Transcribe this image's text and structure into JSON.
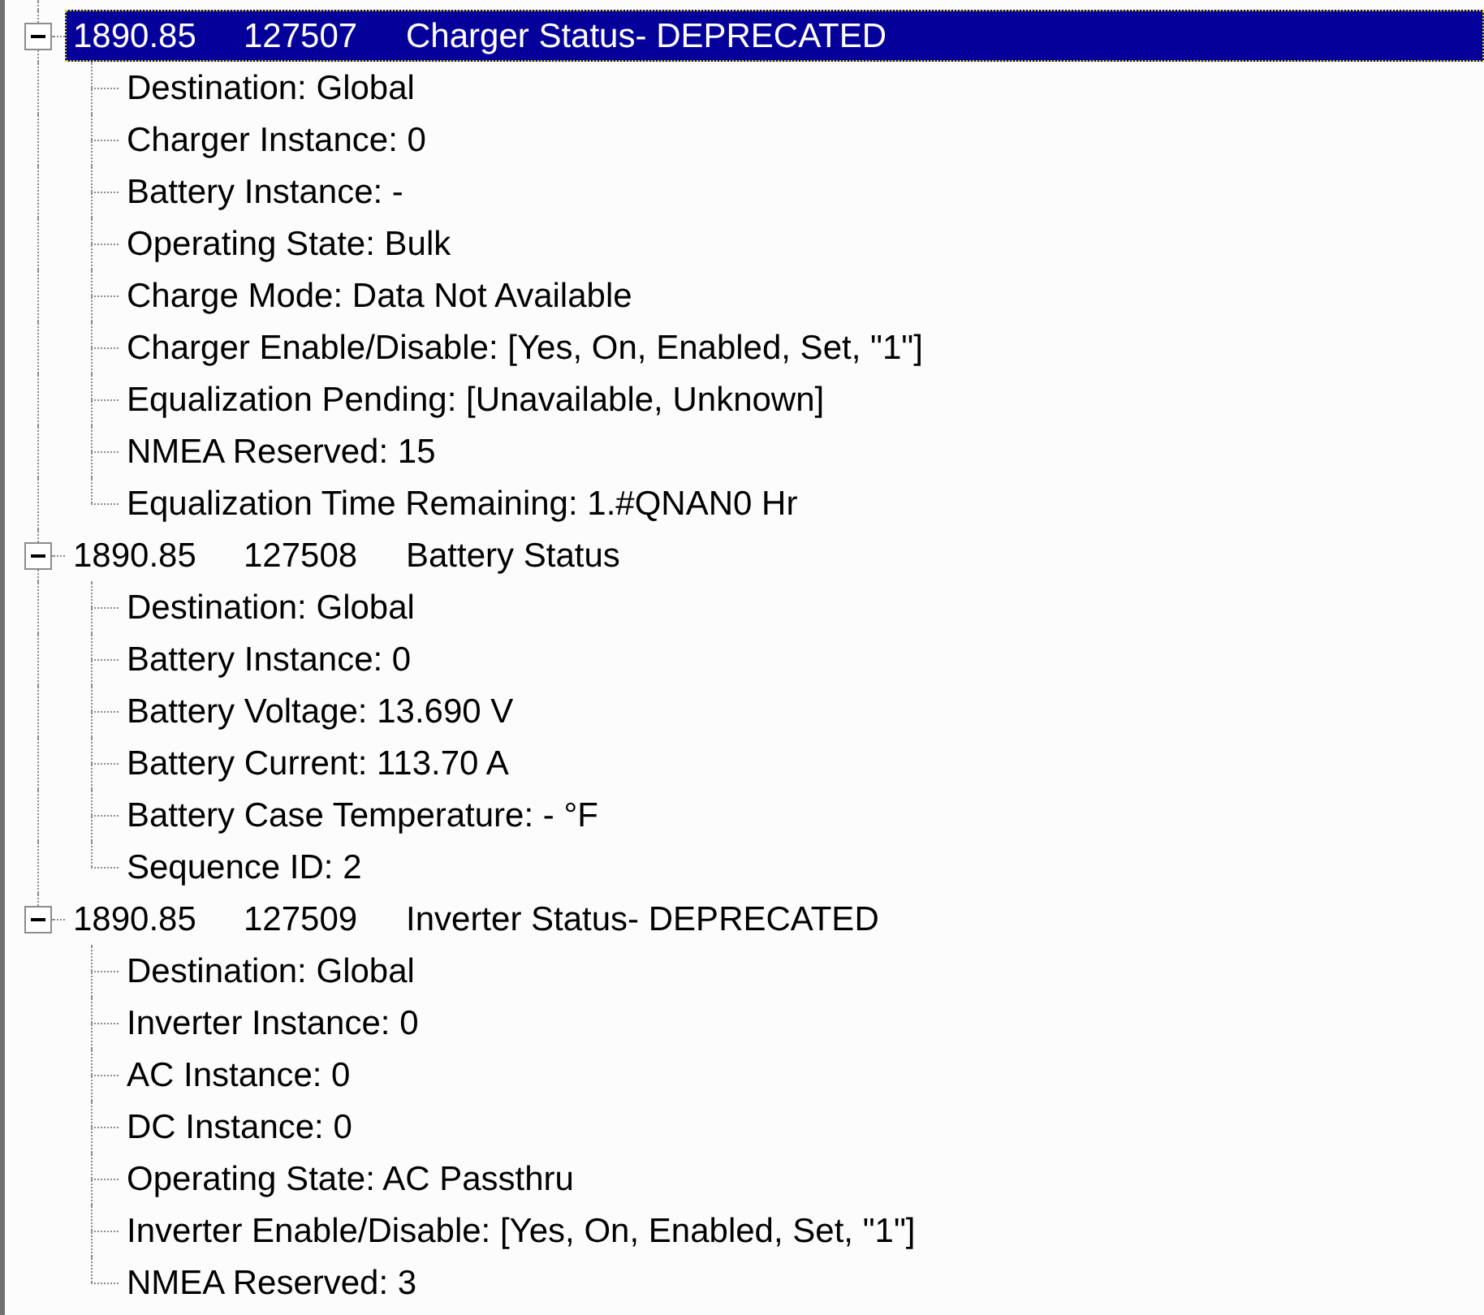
{
  "tree": {
    "nodes": [
      {
        "time": "1890.85",
        "pgn": "127507",
        "name": "Charger Status- DEPRECATED",
        "selected": true,
        "expanded": true,
        "children": [
          {
            "text": "Destination: Global",
            "selected": false
          },
          {
            "text": "Charger Instance: 0",
            "selected": false
          },
          {
            "text": "Battery Instance: -",
            "selected": false
          },
          {
            "text": "Operating State: Bulk",
            "selected": false
          },
          {
            "text": "Charge Mode: Data Not Available",
            "selected": false
          },
          {
            "text": "Charger Enable/Disable: [Yes, On, Enabled, Set, \"1\"]",
            "selected": false
          },
          {
            "text": "Equalization Pending: [Unavailable, Unknown]",
            "selected": false
          },
          {
            "text": "NMEA Reserved: 15",
            "selected": false
          },
          {
            "text": "Equalization Time Remaining: 1.#QNAN0 Hr",
            "selected": false
          }
        ]
      },
      {
        "time": "1890.85",
        "pgn": "127508",
        "name": "Battery Status",
        "selected": false,
        "expanded": true,
        "children": [
          {
            "text": "Destination: Global",
            "selected": false
          },
          {
            "text": "Battery Instance: 0",
            "selected": false
          },
          {
            "text": "Battery Voltage: 13.690 V",
            "selected": false
          },
          {
            "text": "Battery Current: 113.70 A",
            "selected": false
          },
          {
            "text": "Battery Case Temperature: - °F",
            "selected": false
          },
          {
            "text": "Sequence ID: 2",
            "selected": false
          }
        ]
      },
      {
        "time": "1890.85",
        "pgn": "127509",
        "name": "Inverter Status- DEPRECATED",
        "selected": false,
        "expanded": true,
        "children": [
          {
            "text": "Destination: Global",
            "selected": false
          },
          {
            "text": "Inverter Instance: 0",
            "selected": false
          },
          {
            "text": "AC Instance: 0",
            "selected": false
          },
          {
            "text": "DC Instance: 0",
            "selected": false
          },
          {
            "text": "Operating State: AC Passthru",
            "selected": false
          },
          {
            "text": "Inverter Enable/Disable: [Yes, On, Enabled, Set, \"1\"]",
            "selected": false
          },
          {
            "text": "NMEA Reserved: 3",
            "selected": false
          }
        ]
      }
    ]
  }
}
